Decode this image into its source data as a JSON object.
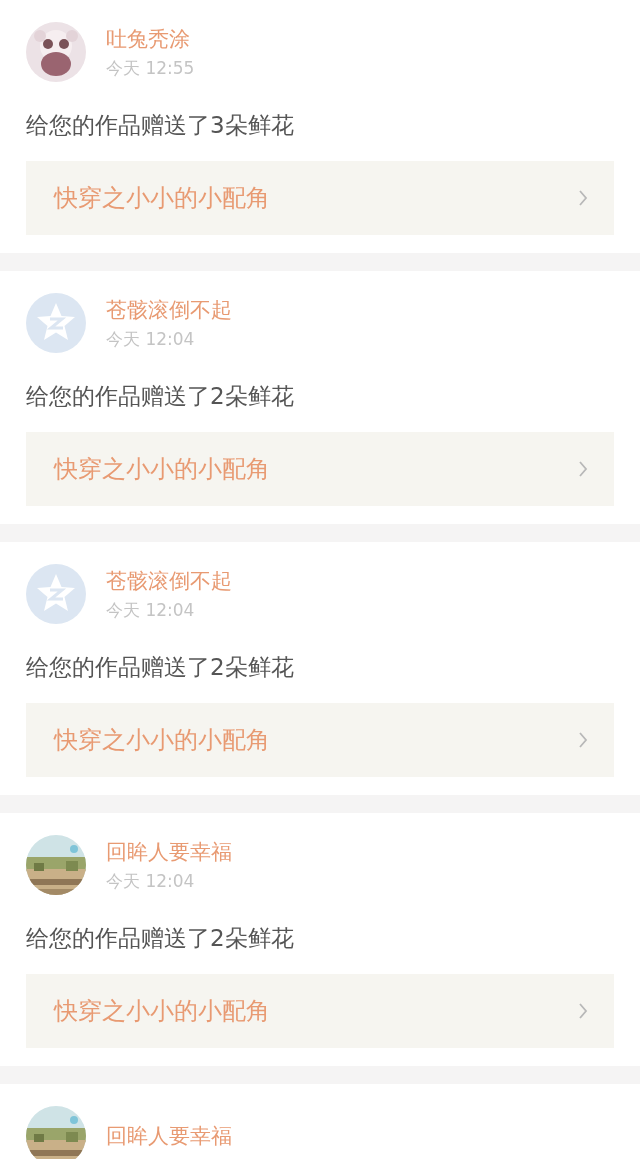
{
  "notifications": [
    {
      "avatar": {
        "kind": "illustration"
      },
      "name": "吐兔秃涂",
      "time": "今天 12:55",
      "message": "给您的作品赠送了3朵鲜花",
      "book": "快穿之小小的小配角"
    },
    {
      "avatar": {
        "kind": "default"
      },
      "name": "苍骸滚倒不起",
      "time": "今天 12:04",
      "message": "给您的作品赠送了2朵鲜花",
      "book": "快穿之小小的小配角"
    },
    {
      "avatar": {
        "kind": "default"
      },
      "name": "苍骸滚倒不起",
      "time": "今天 12:04",
      "message": "给您的作品赠送了2朵鲜花",
      "book": "快穿之小小的小配角"
    },
    {
      "name": "回眸人要幸福",
      "time": "今天 12:04",
      "message": "给您的作品赠送了2朵鲜花",
      "book": "快穿之小小的小配角"
    },
    {
      "name": "回眸人要幸福"
    }
  ]
}
